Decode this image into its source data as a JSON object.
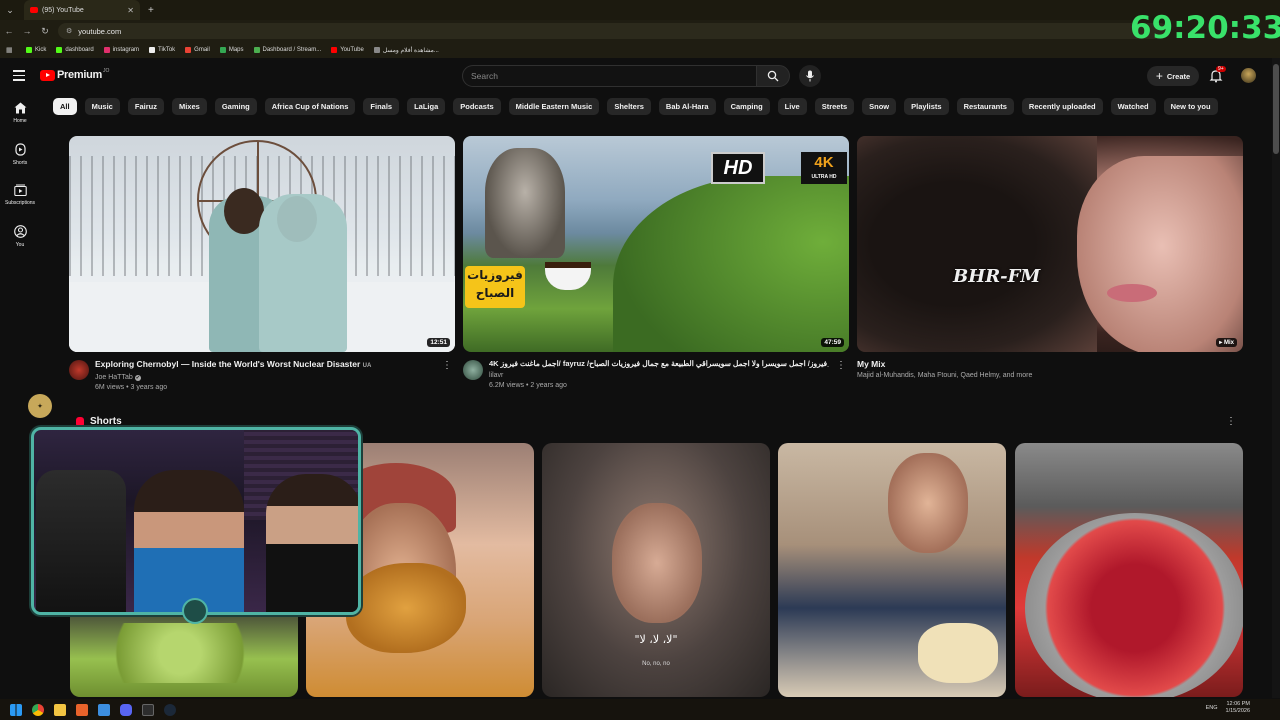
{
  "browser": {
    "tab_title": "(95) YouTube",
    "url": "youtube.com",
    "bookmarks": [
      {
        "label": "Kick",
        "color": "#53fc18"
      },
      {
        "label": "dashboard",
        "color": "#53fc18"
      },
      {
        "label": "instagram",
        "color": "#e1306c"
      },
      {
        "label": "TikTok",
        "color": "#eeeeee"
      },
      {
        "label": "Gmail",
        "color": "#ea4335"
      },
      {
        "label": "Maps",
        "color": "#34a853"
      },
      {
        "label": "Dashboard / Stream...",
        "color": "#4caf50"
      },
      {
        "label": "YouTube",
        "color": "#ff0000"
      },
      {
        "label": "مشاهدة أفلام ومسل...",
        "color": "#888888"
      }
    ]
  },
  "overlay": {
    "timer": "69:20:33"
  },
  "masthead": {
    "brand": "Premium",
    "country": "JO",
    "search_placeholder": "Search",
    "create_label": "Create",
    "notification_count": "9+"
  },
  "rail": [
    {
      "label": "Home"
    },
    {
      "label": "Shorts"
    },
    {
      "label": "Subscriptions"
    },
    {
      "label": "You"
    }
  ],
  "chips": [
    "All",
    "Music",
    "Fairuz",
    "Mixes",
    "Gaming",
    "Africa Cup of Nations",
    "Finals",
    "LaLiga",
    "Podcasts",
    "Middle Eastern Music",
    "Shelters",
    "Bab Al-Hara",
    "Camping",
    "Live",
    "Streets",
    "Snow",
    "Playlists",
    "Restaurants",
    "Recently uploaded",
    "Watched",
    "New to you"
  ],
  "videos": [
    {
      "title": "Exploring Chernobyl — Inside the World's Worst Nuclear Disaster",
      "title_suffix": "UA",
      "channel": "Joe HaTTab",
      "verified": "✔",
      "views": "6M views",
      "age": "3 years ago",
      "duration": "12:51"
    },
    {
      "title": "4K اجمل ماغنت فيروز/ fayruz /فيروز/ اجمل سويسرا ولا اجمل سويسراقي الطبيعة مع جمال فيروزيات الصباح_fayruz_فيروز",
      "channel": "lilavr",
      "views": "6.2M views",
      "age": "2 years ago",
      "duration": "47:59",
      "overlay_hd": "HD",
      "overlay_4k": "4K",
      "overlay_ultra": "ULTRA HD",
      "overlay_arabic_1": "فيروزيات",
      "overlay_arabic_2": "الصباح"
    },
    {
      "title": "My Mix",
      "subtitle": "Majid al-Muhandis, Maha Ftouni, Qaed Helmy, and more",
      "watermark": "BHR-FM",
      "badge": "Mix"
    }
  ],
  "shorts": {
    "heading": "Shorts",
    "caption_main": "\"لا، لا، لا\"",
    "caption_sub": "No, no, no"
  },
  "taskbar": {
    "lang": "ENG",
    "time": "12:06 PM",
    "date": "1/15/2026"
  }
}
